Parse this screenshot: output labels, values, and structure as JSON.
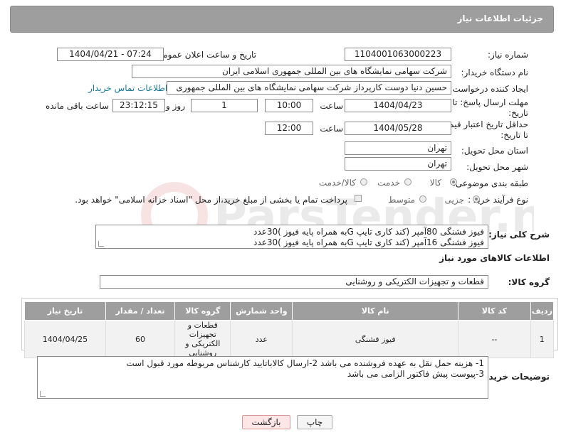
{
  "header": {
    "title": "جزئیات اطلاعات نیاز"
  },
  "fields": {
    "need_number_label": "شماره نیاز:",
    "need_number": "1104001063000223",
    "announce_label": "تاریخ و ساعت اعلان عمومی:",
    "announce_value": "1404/04/21 - 07:24",
    "buyer_org_label": "نام دستگاه خریدار:",
    "buyer_org": "شرکت سهامی نمایشگاه های بین المللی جمهوری اسلامی ایران",
    "creator_label": "ایجاد کننده درخواست:",
    "creator": "حسین دنیا دوست کارپرداز شرکت سهامی نمایشگاه های بین المللی جمهوری",
    "contact_link": "اطلاعات تماس خریدار",
    "deadline_label_1": "مهلت ارسال پاسخ: تا",
    "deadline_label_2": "تاریخ:",
    "deadline_date": "1404/04/23",
    "time_label": "ساعت",
    "deadline_time": "10:00",
    "days_value": "1",
    "days_label": "روز و",
    "remaining_time": "23:12:15",
    "remaining_label": "ساعت باقی مانده",
    "validity_label_1": "حداقل تاریخ اعتبار قیمت:",
    "validity_label_2": "تا تاریخ:",
    "validity_date": "1404/05/28",
    "validity_time": "12:00",
    "province_label": "استان محل تحویل:",
    "province": "تهران",
    "city_label": "شهر محل تحویل:",
    "city": "تهران",
    "category_label": "طبقه بندی موضوعی:",
    "cat_goods": "کالا",
    "cat_service": "خدمت",
    "cat_both": "کالا/خدمت",
    "process_label": "نوع فرآیند خرید :",
    "proc_minor": "جزیی",
    "proc_medium": "متوسط",
    "payment_note": "پرداخت تمام یا بخشی از مبلغ خرید،از محل \"اسناد خزانه اسلامی\" خواهد بود."
  },
  "description": {
    "label": "شرح کلی نیاز:",
    "line1": "فیوز فشنگی 80آمپر (کند کاری تایپ Gبه همراه پایه فیوز )30عدد",
    "line2": "فیوز فشنگی 16آمپر (کند کاری تایپ Gبه همراه پایه فیوز )30عدد"
  },
  "goods_info": {
    "section_title": "اطلاعات کالاهای مورد نیاز",
    "group_label": "گروه کالا:",
    "group_value": "قطعات و تجهیزات الکتریکی و روشنایی"
  },
  "table": {
    "headers": [
      "ردیف",
      "کد کالا",
      "نام کالا",
      "واحد شمارش",
      "گروه کالا",
      "تعداد / مقدار",
      "تاریخ نیاز"
    ],
    "rows": [
      {
        "row": "1",
        "code": "--",
        "name": "فیوز فشنگی",
        "unit": "عدد",
        "group": "قطعات و تجهیزات الکتریکی و روشنایی",
        "qty": "60",
        "date": "1404/04/25"
      }
    ]
  },
  "buyer_notes": {
    "label": "توضیحات خریدار:",
    "line1": "1- هزینه حمل نقل به عهده فروشنده می باشد 2-ارسال کالاباتایید کارشناس مربوطه مورد قبول است",
    "line2": "3-پیوست پیش فاکتور الزامی می باشد"
  },
  "buttons": {
    "print": "چاپ",
    "back": "بازگشت"
  },
  "watermark": {
    "text": "ParsTender.net"
  },
  "colors": {
    "header_bg": "#9e9e9e",
    "link": "#1a7a9a",
    "back_bg": "#ffe7e7"
  }
}
